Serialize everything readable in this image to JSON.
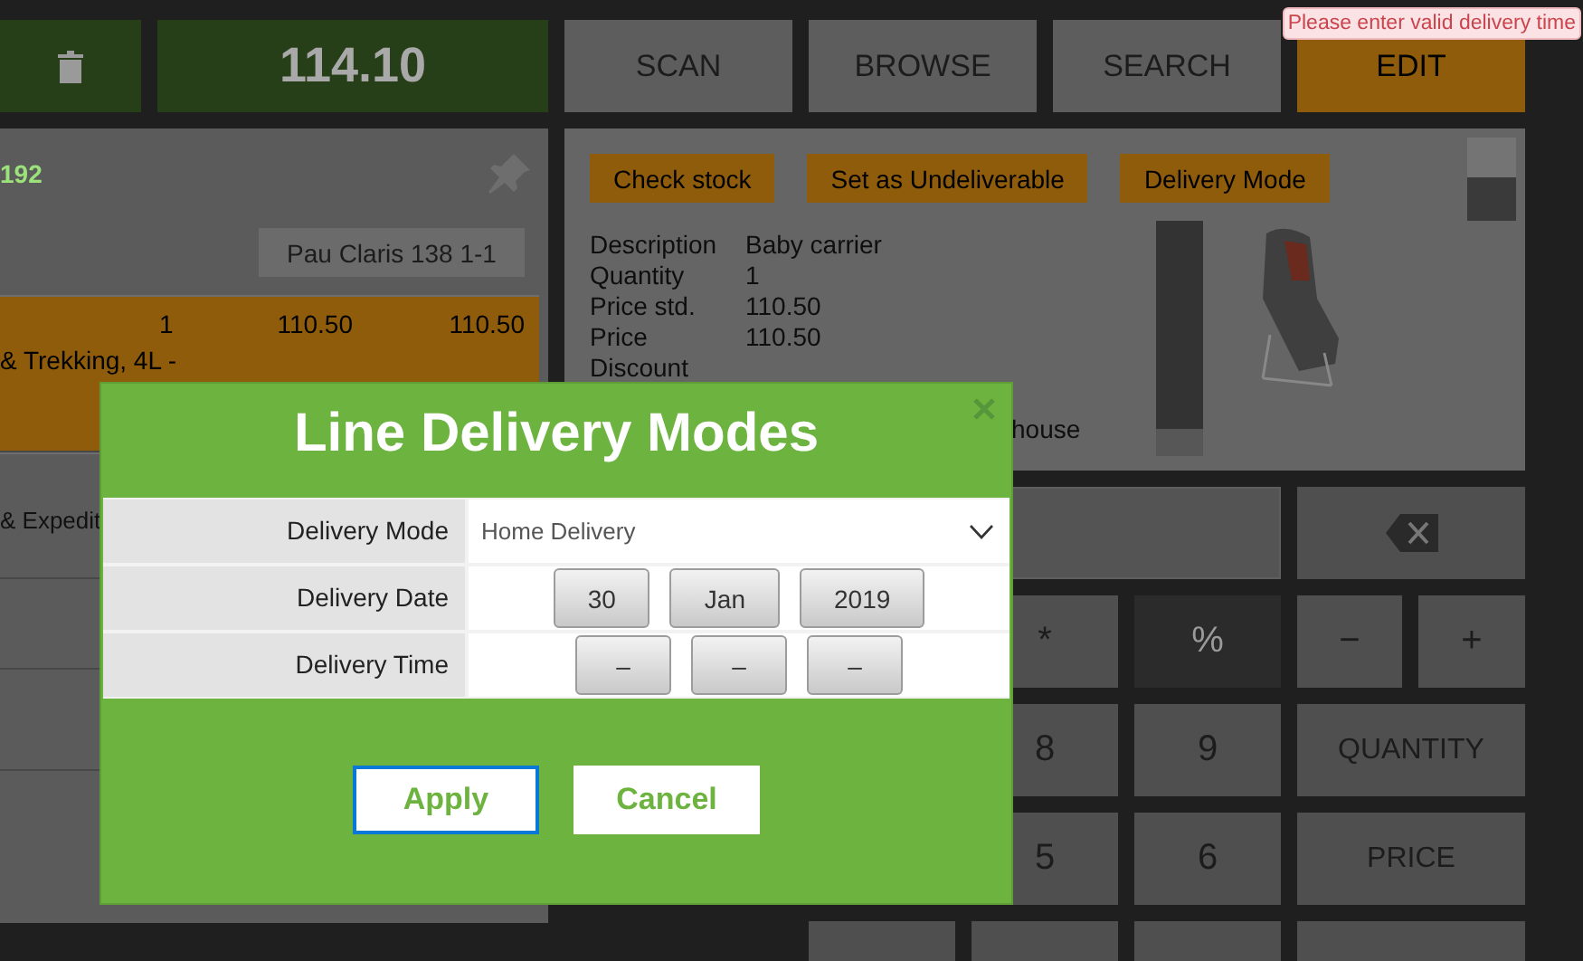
{
  "tooltip": {
    "text": "Please enter valid delivery time"
  },
  "top_bar": {
    "total": "114.10",
    "buttons": [
      {
        "label": "SCAN",
        "selected": false
      },
      {
        "label": "BROWSE",
        "selected": false
      },
      {
        "label": "SEARCH",
        "selected": false
      },
      {
        "label": "EDIT",
        "selected": true
      }
    ]
  },
  "ticket": {
    "number": "192",
    "location": "Pau Claris 138 1-1",
    "lines": [
      {
        "description": "& Trekking, 4L -",
        "quantity": "1",
        "price": "110.50",
        "total": "110.50",
        "selected": true
      },
      {
        "description": "& Expedit",
        "selected": false
      }
    ]
  },
  "line_details": {
    "actions": [
      "Check stock",
      "Set as Undeliverable",
      "Delivery Mode"
    ],
    "fields": [
      {
        "label": "Description",
        "value": "Baby carrier"
      },
      {
        "label": "Quantity",
        "value": "1"
      },
      {
        "label": "Price std.",
        "value": "110.50"
      },
      {
        "label": "Price",
        "value": "110.50"
      },
      {
        "label": "Discount"
      }
    ],
    "hidden_row_tail": "house"
  },
  "keypad": {
    "rows": [
      [
        {
          "label": "*",
          "kind": "key",
          "disabled": false
        },
        {
          "label": "%",
          "kind": "key",
          "disabled": true
        },
        {
          "label": "−",
          "kind": "key",
          "disabled": false
        },
        {
          "label": "+",
          "kind": "key",
          "disabled": false
        }
      ],
      [
        {
          "label": "8",
          "kind": "key",
          "disabled": false
        },
        {
          "label": "9",
          "kind": "key",
          "disabled": false
        },
        {
          "label": "QUANTITY",
          "kind": "wide",
          "disabled": false
        }
      ],
      [
        {
          "label": "5",
          "kind": "key",
          "disabled": false
        },
        {
          "label": "6",
          "kind": "key",
          "disabled": false
        },
        {
          "label": "PRICE",
          "kind": "wide",
          "disabled": false
        }
      ]
    ]
  },
  "dialog": {
    "title": "Line Delivery Modes",
    "fields": [
      {
        "label": "Delivery Mode",
        "kind": "select",
        "value": "Home Delivery"
      },
      {
        "label": "Delivery Date",
        "kind": "buttons",
        "parts": [
          "30",
          "Jan",
          "2019"
        ]
      },
      {
        "label": "Delivery Time",
        "kind": "buttons",
        "parts": [
          "–",
          "–",
          "–"
        ]
      }
    ],
    "buttons": [
      {
        "label": "Apply",
        "focused": true
      },
      {
        "label": "Cancel",
        "focused": false
      }
    ]
  }
}
